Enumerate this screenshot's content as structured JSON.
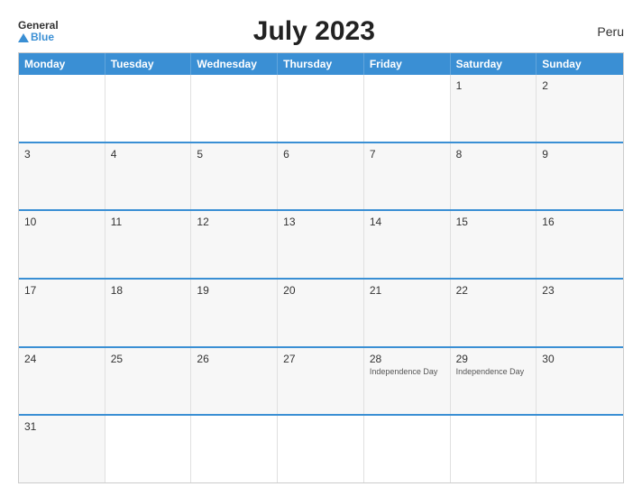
{
  "header": {
    "logo_general": "General",
    "logo_blue": "Blue",
    "title": "July 2023",
    "country": "Peru"
  },
  "calendar": {
    "weekdays": [
      "Monday",
      "Tuesday",
      "Wednesday",
      "Thursday",
      "Friday",
      "Saturday",
      "Sunday"
    ],
    "rows": [
      [
        {
          "day": "",
          "empty": true
        },
        {
          "day": "",
          "empty": true
        },
        {
          "day": "",
          "empty": true
        },
        {
          "day": "",
          "empty": true
        },
        {
          "day": "",
          "empty": true
        },
        {
          "day": "1",
          "event": ""
        },
        {
          "day": "2",
          "event": ""
        }
      ],
      [
        {
          "day": "3",
          "event": ""
        },
        {
          "day": "4",
          "event": ""
        },
        {
          "day": "5",
          "event": ""
        },
        {
          "day": "6",
          "event": ""
        },
        {
          "day": "7",
          "event": ""
        },
        {
          "day": "8",
          "event": ""
        },
        {
          "day": "9",
          "event": ""
        }
      ],
      [
        {
          "day": "10",
          "event": ""
        },
        {
          "day": "11",
          "event": ""
        },
        {
          "day": "12",
          "event": ""
        },
        {
          "day": "13",
          "event": ""
        },
        {
          "day": "14",
          "event": ""
        },
        {
          "day": "15",
          "event": ""
        },
        {
          "day": "16",
          "event": ""
        }
      ],
      [
        {
          "day": "17",
          "event": ""
        },
        {
          "day": "18",
          "event": ""
        },
        {
          "day": "19",
          "event": ""
        },
        {
          "day": "20",
          "event": ""
        },
        {
          "day": "21",
          "event": ""
        },
        {
          "day": "22",
          "event": ""
        },
        {
          "day": "23",
          "event": ""
        }
      ],
      [
        {
          "day": "24",
          "event": ""
        },
        {
          "day": "25",
          "event": ""
        },
        {
          "day": "26",
          "event": ""
        },
        {
          "day": "27",
          "event": ""
        },
        {
          "day": "28",
          "event": "Independence Day"
        },
        {
          "day": "29",
          "event": "Independence Day"
        },
        {
          "day": "30",
          "event": ""
        }
      ],
      [
        {
          "day": "31",
          "event": ""
        },
        {
          "day": "",
          "empty": true
        },
        {
          "day": "",
          "empty": true
        },
        {
          "day": "",
          "empty": true
        },
        {
          "day": "",
          "empty": true
        },
        {
          "day": "",
          "empty": true
        },
        {
          "day": "",
          "empty": true
        }
      ]
    ]
  }
}
